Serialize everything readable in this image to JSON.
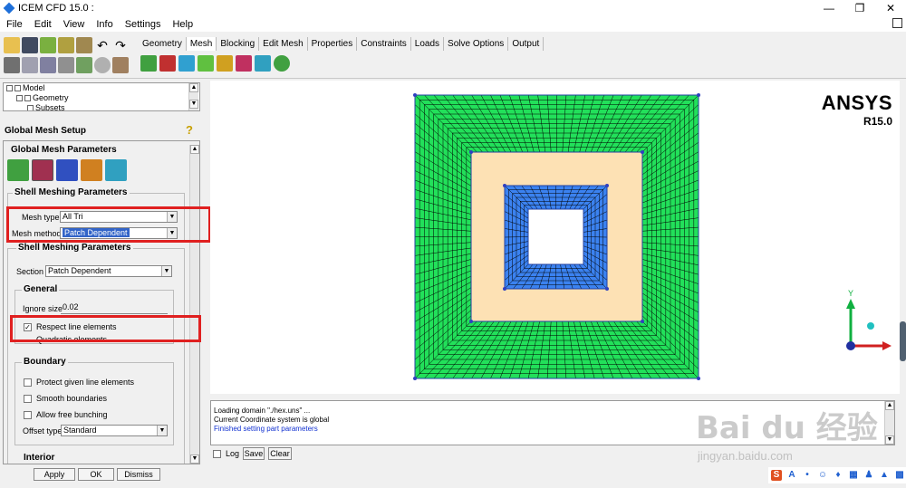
{
  "window": {
    "title": "ICEM CFD 15.0 :"
  },
  "menu": [
    "File",
    "Edit",
    "View",
    "Info",
    "Settings",
    "Help"
  ],
  "tabs": [
    {
      "label": "Geometry"
    },
    {
      "label": "Mesh",
      "active": true
    },
    {
      "label": "Blocking"
    },
    {
      "label": "Edit Mesh"
    },
    {
      "label": "Properties"
    },
    {
      "label": "Constraints"
    },
    {
      "label": "Loads"
    },
    {
      "label": "Solve Options"
    },
    {
      "label": "Output"
    }
  ],
  "tree": {
    "items": [
      "Model",
      "Geometry",
      "Subsets"
    ]
  },
  "panel": {
    "title": "Global Mesh Setup",
    "global_params_title": "Global Mesh Parameters",
    "shell_group1_title": "Shell Meshing Parameters",
    "mesh_type_label": "Mesh type",
    "mesh_type_value": "All Tri",
    "mesh_method_label": "Mesh method",
    "mesh_method_value": "Patch Dependent",
    "shell_group2_title": "Shell Meshing Parameters",
    "section_label": "Section",
    "section_value": "Patch Dependent",
    "general_title": "General",
    "ignore_size_label": "Ignore size",
    "ignore_size_value": "0.02",
    "respect_line_label": "Respect line elements",
    "respect_line_checked": true,
    "quadratic_label": "Quadratic elements",
    "boundary_title": "Boundary",
    "protect_label": "Protect given line elements",
    "smooth_label": "Smooth boundaries",
    "free_bunching_label": "Allow free bunching",
    "offset_type_label": "Offset type",
    "offset_type_value": "Standard",
    "interior_title": "Interior"
  },
  "buttons": {
    "apply": "Apply",
    "ok": "OK",
    "dismiss": "Dismiss"
  },
  "brand": {
    "name": "ANSYS",
    "version": "R15.0"
  },
  "mesh_colors": {
    "outer": "#22e05a",
    "middle": "#fde1b4",
    "inner": "#3b82f0",
    "line": "#000000",
    "node": "#3040c0"
  },
  "axis": {
    "y_label": "Y"
  },
  "messages": [
    {
      "text": "Loading domain \"./hex.uns\" ...",
      "color": "#000000"
    },
    {
      "text": "Current Coordinate system is global",
      "color": "#000000"
    },
    {
      "text": "Finished setting part parameters",
      "color": "#1030d0"
    }
  ],
  "message_controls": {
    "log_label": "Log",
    "save_label": "Save",
    "clear_label": "Clear"
  },
  "watermark": {
    "logo": "Bai du 经验",
    "url": "jingyan.baidu.com"
  },
  "highlight_color": "#e02020"
}
